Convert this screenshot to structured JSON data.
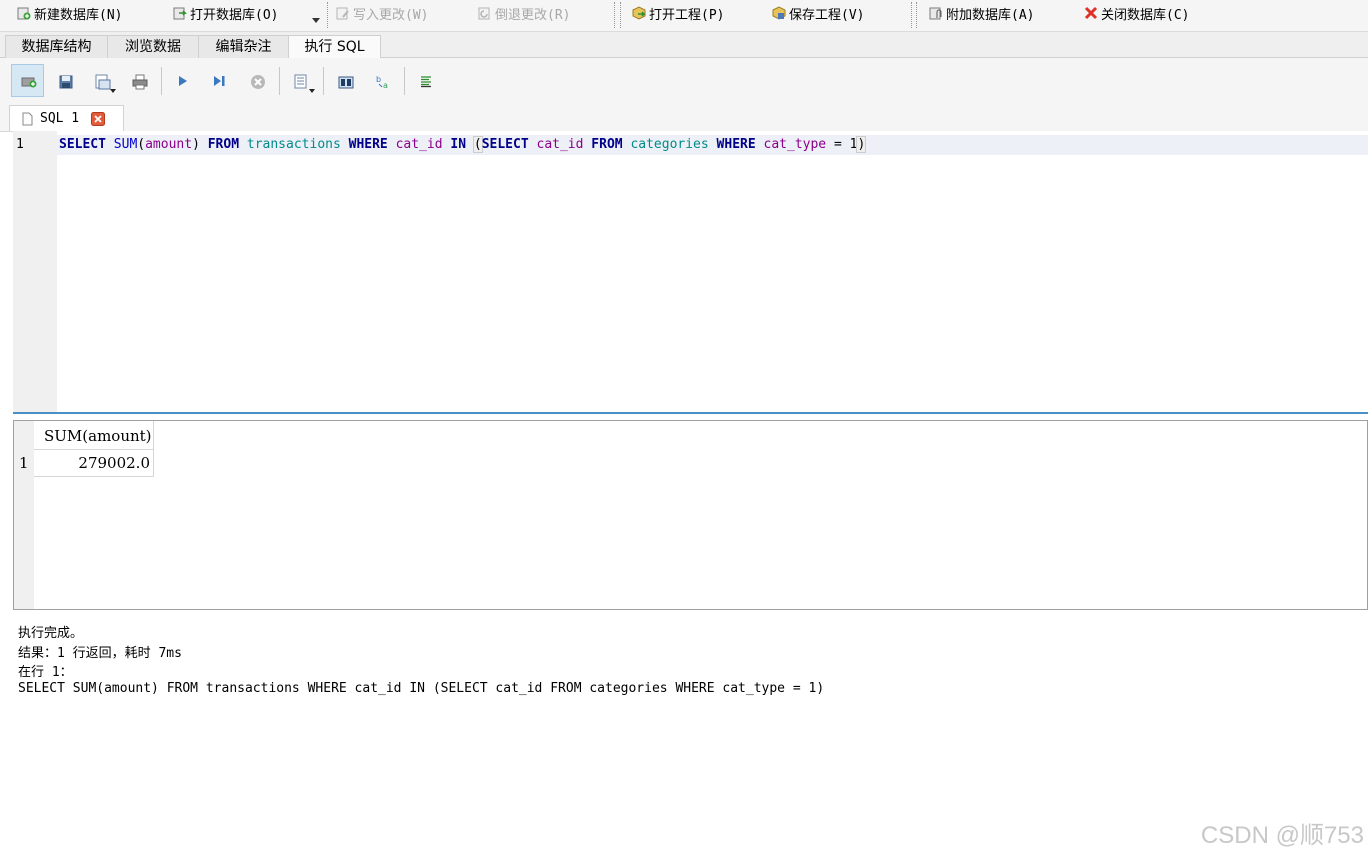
{
  "toolbar": {
    "new_db": "新建数据库(N)",
    "open_db": "打开数据库(O)",
    "write_changes": "写入更改(W)",
    "revert_changes": "倒退更改(R)",
    "open_project": "打开工程(P)",
    "save_project": "保存工程(V)",
    "attach_db": "附加数据库(A)",
    "close_db": "关闭数据库(C)"
  },
  "tabs": [
    {
      "label": "数据库结构"
    },
    {
      "label": "浏览数据"
    },
    {
      "label": "编辑杂注"
    },
    {
      "label": "执行 SQL"
    }
  ],
  "sql_tab": {
    "label": "SQL 1"
  },
  "editor": {
    "line_number": "1",
    "tokens": {
      "t1": "SELECT",
      "t2": "SUM",
      "t3": "(",
      "t4": "amount",
      "t5": ")",
      "t6": "FROM",
      "t7": "transactions",
      "t8": "WHERE",
      "t9": "cat_id",
      "t10": "IN",
      "t11": "(",
      "t12": "SELECT",
      "t13": "cat_id",
      "t14": "FROM",
      "t15": "categories",
      "t16": "WHERE",
      "t17": "cat_type",
      "t18": "=",
      "t19": "1",
      "t20": ")"
    }
  },
  "results": {
    "columns": [
      "SUM(amount)"
    ],
    "rows": [
      {
        "row_number": "1",
        "values": [
          "279002.0"
        ]
      }
    ]
  },
  "messages": {
    "line1": "执行完成。",
    "line2": "结果：1 行返回，耗时 7ms",
    "line3": "在行 1：",
    "line4": "SELECT SUM(amount) FROM transactions WHERE cat_id IN (SELECT cat_id FROM categories WHERE cat_type = 1)"
  },
  "watermark": "CSDN @顺753",
  "colors": {
    "keyword": "#00008b",
    "table": "#008b8b",
    "column": "#8b008b",
    "accent": "#4a90c8"
  }
}
